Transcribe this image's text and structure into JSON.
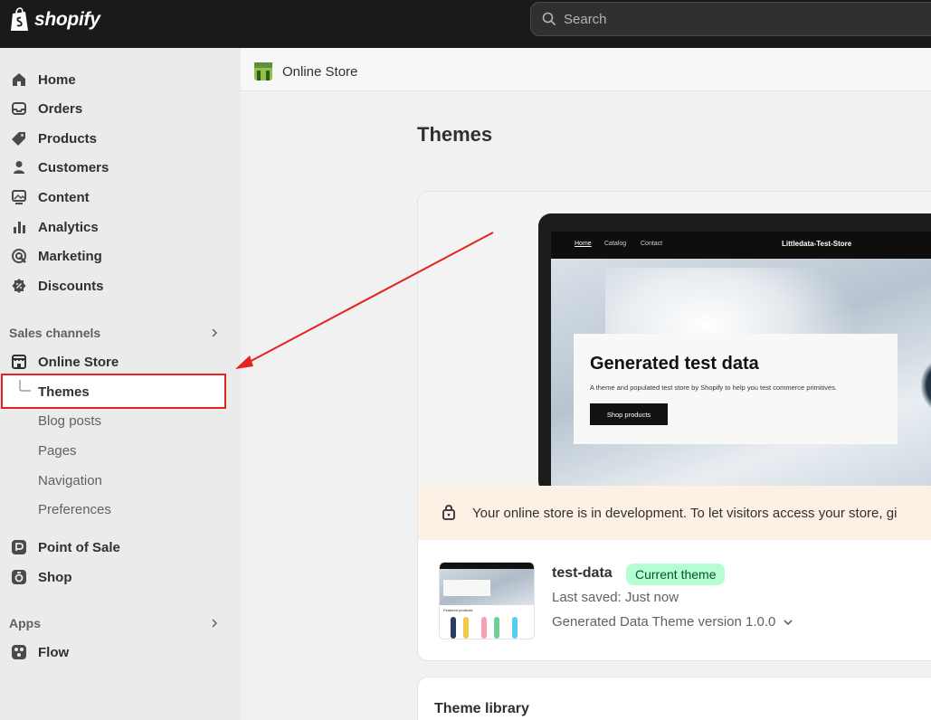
{
  "topbar": {
    "logo_text": "shopify",
    "search_placeholder": "Search"
  },
  "sidebar": {
    "main_items": [
      {
        "label": "Home",
        "icon": "home-icon"
      },
      {
        "label": "Orders",
        "icon": "inbox-icon"
      },
      {
        "label": "Products",
        "icon": "tag-icon"
      },
      {
        "label": "Customers",
        "icon": "person-icon"
      },
      {
        "label": "Content",
        "icon": "image-icon"
      },
      {
        "label": "Analytics",
        "icon": "bar-chart-icon"
      },
      {
        "label": "Marketing",
        "icon": "target-icon"
      },
      {
        "label": "Discounts",
        "icon": "discount-icon"
      }
    ],
    "sales_channels_title": "Sales channels",
    "online_store": "Online Store",
    "online_store_sub": [
      "Themes",
      "Blog posts",
      "Pages",
      "Navigation",
      "Preferences"
    ],
    "point_of_sale": "Point of Sale",
    "shop": "Shop",
    "apps_title": "Apps",
    "flow": "Flow"
  },
  "main": {
    "breadcrumb": "Online Store",
    "page_title": "Themes",
    "preview": {
      "nav_links": [
        "Home",
        "Catalog",
        "Contact"
      ],
      "store_name": "Littledata-Test-Store",
      "hero_title": "Generated test data",
      "hero_subtitle": "A theme and populated test store by Shopify to help you test commerce primitives.",
      "hero_button": "Shop products"
    },
    "dev_banner": "Your online store is in development. To let visitors access your store, gi",
    "theme": {
      "name": "test-data",
      "badge": "Current theme",
      "saved": "Last saved: Just now",
      "version": "Generated Data Theme version 1.0.0",
      "thumb_label": "Featured products"
    },
    "library_title": "Theme library"
  },
  "colors": {
    "highlight": "#e5231d",
    "badge_bg": "#b4fed2",
    "topbar": "#1a1a1a"
  }
}
